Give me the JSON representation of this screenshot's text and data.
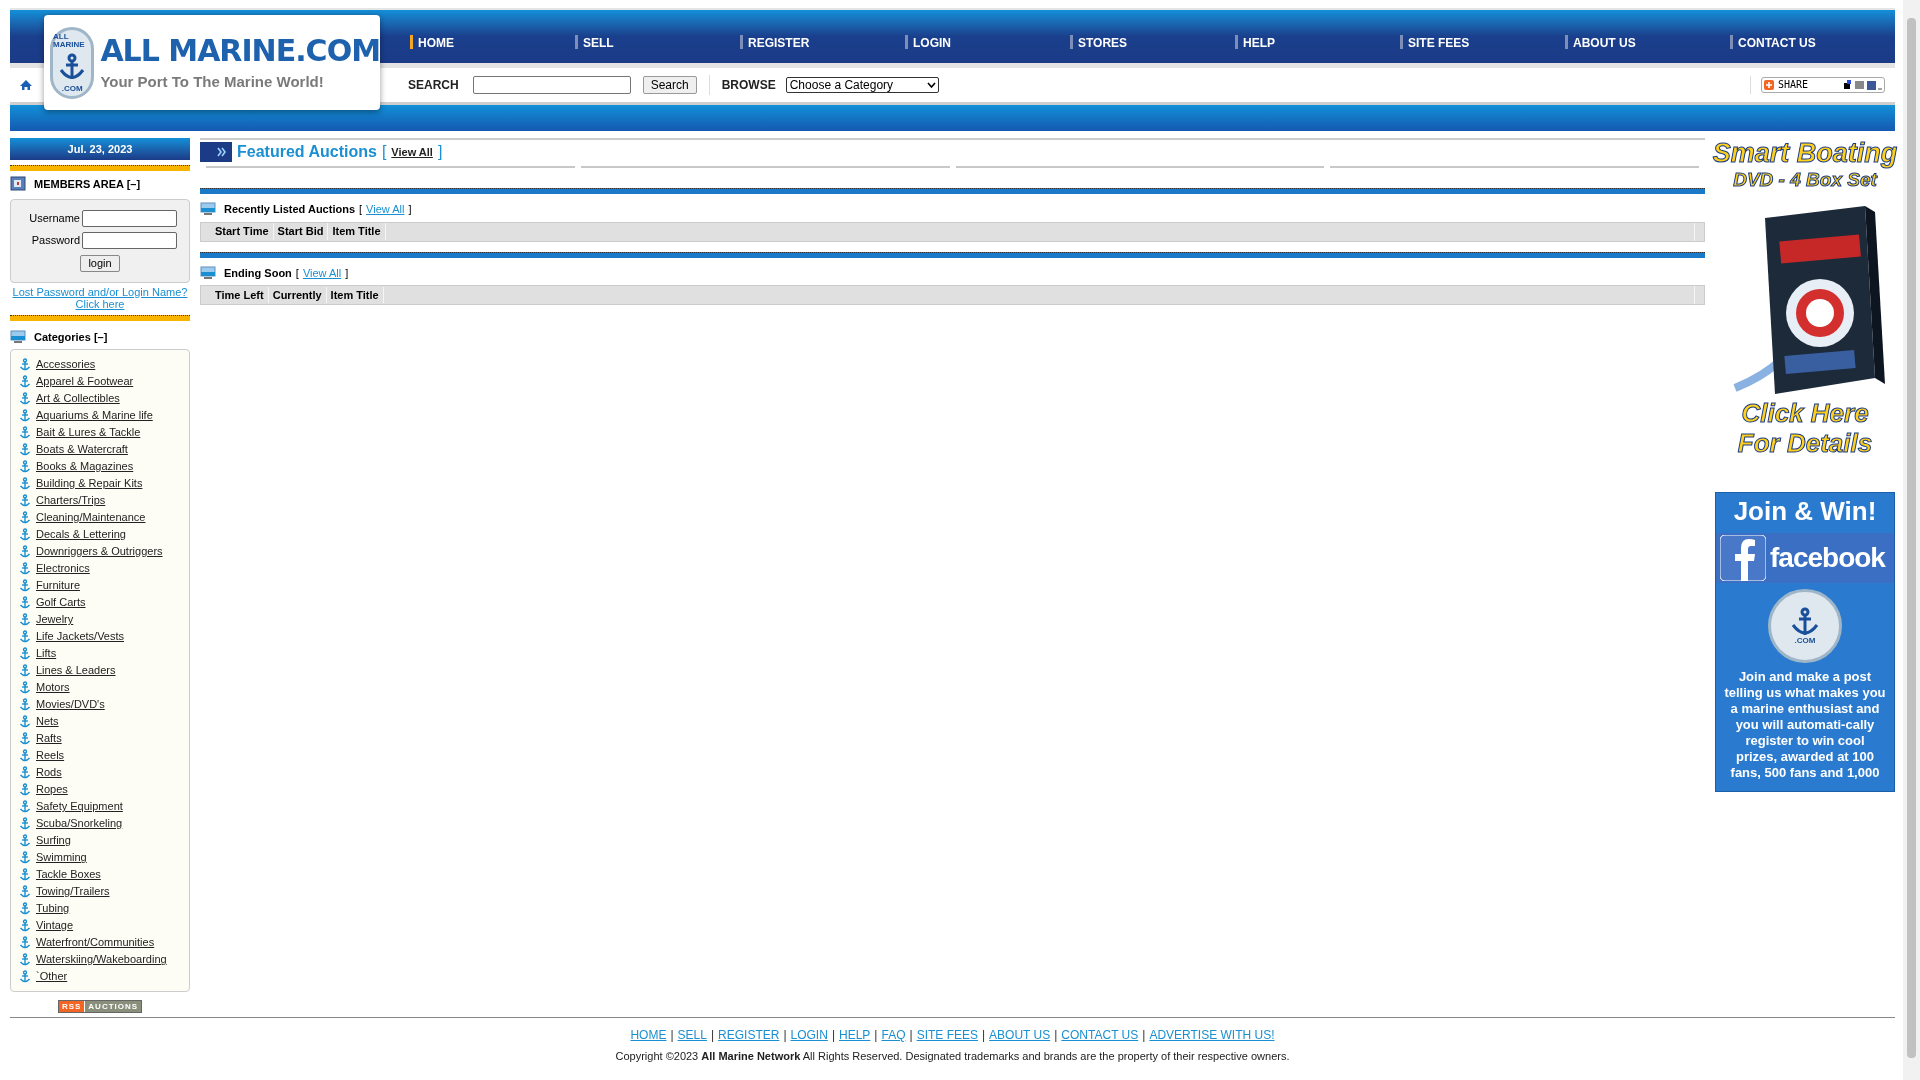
{
  "header": {
    "logo": {
      "badge_top": "ALL MARINE",
      "badge_bottom": ".COM",
      "title": "ALL MARINE.COM",
      "tagline": "Your Port To The Marine World!"
    },
    "nav": [
      {
        "label": "HOME",
        "selected": true
      },
      {
        "label": "SELL",
        "selected": false
      },
      {
        "label": "REGISTER",
        "selected": false
      },
      {
        "label": "LOGIN",
        "selected": false
      },
      {
        "label": "STORES",
        "selected": false
      },
      {
        "label": "HELP",
        "selected": false
      },
      {
        "label": "SITE FEES",
        "selected": false
      },
      {
        "label": "ABOUT US",
        "selected": false
      },
      {
        "label": "CONTACT US",
        "selected": false
      }
    ],
    "search": {
      "label": "SEARCH",
      "button": "Search"
    },
    "browse": {
      "label": "BROWSE",
      "value": "Choose a Category"
    },
    "share": {
      "label": "SHARE"
    }
  },
  "sidebar": {
    "date": "Jul. 23, 2023",
    "members": {
      "title": "MEMBERS AREA [–]",
      "username_label": "Username",
      "password_label": "Password",
      "button": "login",
      "lost_link": "Lost Password and/or Login Name?",
      "click_here": "Click here"
    },
    "categories": {
      "title": "Categories [–]",
      "items": [
        "Accessories",
        "Apparel & Footwear",
        "Art & Collectibles",
        "Aquariums & Marine life",
        "Bait & Lures & Tackle",
        "Boats & Watercraft",
        "Books & Magazines",
        "Building & Repair Kits",
        "Charters/Trips",
        "Cleaning/Maintenance",
        "Decals & Lettering",
        "Downriggers & Outriggers",
        "Electronics",
        "Furniture",
        "Golf Carts",
        "Jewelry",
        "Life Jackets/Vests",
        "Lifts",
        "Lines & Leaders",
        "Motors",
        "Movies/DVD's",
        "Nets",
        "Rafts",
        "Reels",
        "Rods",
        "Ropes",
        "Safety Equipment",
        "Scuba/Snorkeling",
        "Surfing",
        "Swimming",
        "Tackle Boxes",
        "Towing/Trailers",
        "Tubing",
        "Vintage",
        "Waterfront/Communities",
        "Waterskiing/Wakeboarding",
        "`Other"
      ]
    },
    "rss": {
      "left": "RSS",
      "right": "AUCTIONS"
    }
  },
  "main": {
    "featured": {
      "title": "Featured Auctions",
      "open": "[",
      "view_all": "View All",
      "close": "]"
    },
    "sections": [
      {
        "title": "Recently Listed Auctions",
        "open": "[",
        "view_all": "View All",
        "close": "]",
        "columns": [
          "Start Time",
          "Start Bid",
          "Item Title"
        ]
      },
      {
        "title": "Ending Soon",
        "open": "[",
        "view_all": "View All",
        "close": "]",
        "columns": [
          "Time Left",
          "Currently",
          "Item Title"
        ]
      }
    ]
  },
  "ads": [
    {
      "kind": "dvd",
      "heading": "Smart Boating",
      "subheading": "DVD - 4 Box Set",
      "cta_lines": [
        "Click Here",
        "For Details"
      ]
    },
    {
      "kind": "facebook",
      "heading": "Join & Win!",
      "brand": "facebook",
      "logo_text": ".COM",
      "text": "**Join** and make a post telling us what makes you a marine enthusiast and you will automati-cally register to win cool prizes, awarded at 100 fans, 500 fans and 1,000"
    }
  ],
  "footer": {
    "separator": "|",
    "links": [
      "HOME",
      "SELL",
      "REGISTER",
      "LOGIN",
      "HELP",
      "FAQ",
      "SITE FEES",
      "ABOUT US",
      "CONTACT US",
      "ADVERTISE WITH US!"
    ],
    "copyright": "Copyright ©2023 **All Marine Network** All Rights Reserved. Designated trademarks and brands are the property of their respective owners."
  }
}
